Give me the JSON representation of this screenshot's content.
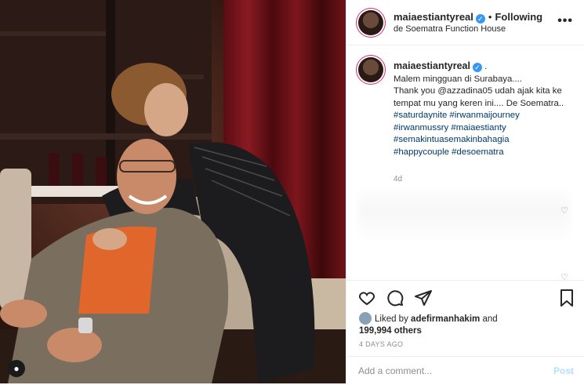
{
  "post": {
    "username": "maiaestiantyreal",
    "verified_mark": "✓",
    "follow_status": "Following",
    "location": "de Soematra Function House",
    "more_icon": "ellipsis-icon"
  },
  "caption": {
    "username": "maiaestiantyreal",
    "suffix": ".",
    "lines": [
      "Malem mingguan di Surabaya....",
      "Thank you @azzadina05 udah ajak kita ke tempat mu yang keren ini.... De Soematra.."
    ],
    "hashtags": [
      "#saturdaynite #irwanmaijourney",
      "#irwanmussry #maiaestianty",
      "#semakintuasemakinbahagia",
      "#happycouple #desoematra"
    ],
    "age": "4d"
  },
  "actions": {
    "like_icon": "heart-icon",
    "comment_icon": "comment-icon",
    "share_icon": "share-icon",
    "save_icon": "bookmark-icon"
  },
  "likes": {
    "prefix": "Liked by",
    "user": "adefirmanhakim",
    "conj": "and",
    "others": "199,994 others"
  },
  "date": "4 DAYS AGO",
  "comment_box": {
    "placeholder": "Add a comment...",
    "post_label": "Post"
  },
  "colors": {
    "link": "#00376b",
    "verified": "#3897f0",
    "muted": "#8e8e8e",
    "post_disabled": "#b2dffc"
  }
}
